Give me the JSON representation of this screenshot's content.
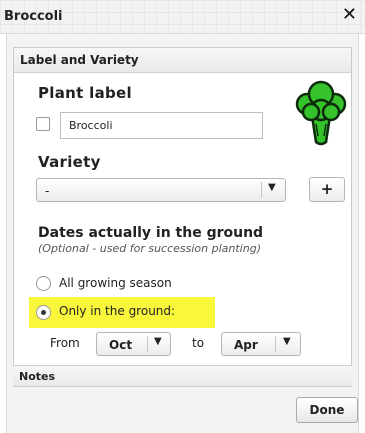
{
  "dialog": {
    "title": "Broccoli",
    "close_icon": "close-icon"
  },
  "section": {
    "header": "Label and Variety"
  },
  "plant_label": {
    "label": "Plant label",
    "checked": false,
    "value": "Broccoli"
  },
  "variety": {
    "label": "Variety",
    "selected": "-",
    "add_label": "+"
  },
  "dates": {
    "title": "Dates actually in the ground",
    "subtitle": "(Optional - used for succession planting)",
    "options": [
      {
        "label": "All growing season",
        "selected": false
      },
      {
        "label": "Only in the ground:",
        "selected": true
      }
    ],
    "from_label": "From",
    "from_value": "Oct",
    "to_label": "to",
    "to_value": "Apr"
  },
  "notes": {
    "header": "Notes"
  },
  "footer": {
    "done_label": "Done"
  },
  "colors": {
    "highlight": "#faf63b",
    "broccoli_green": "#35c22b"
  }
}
